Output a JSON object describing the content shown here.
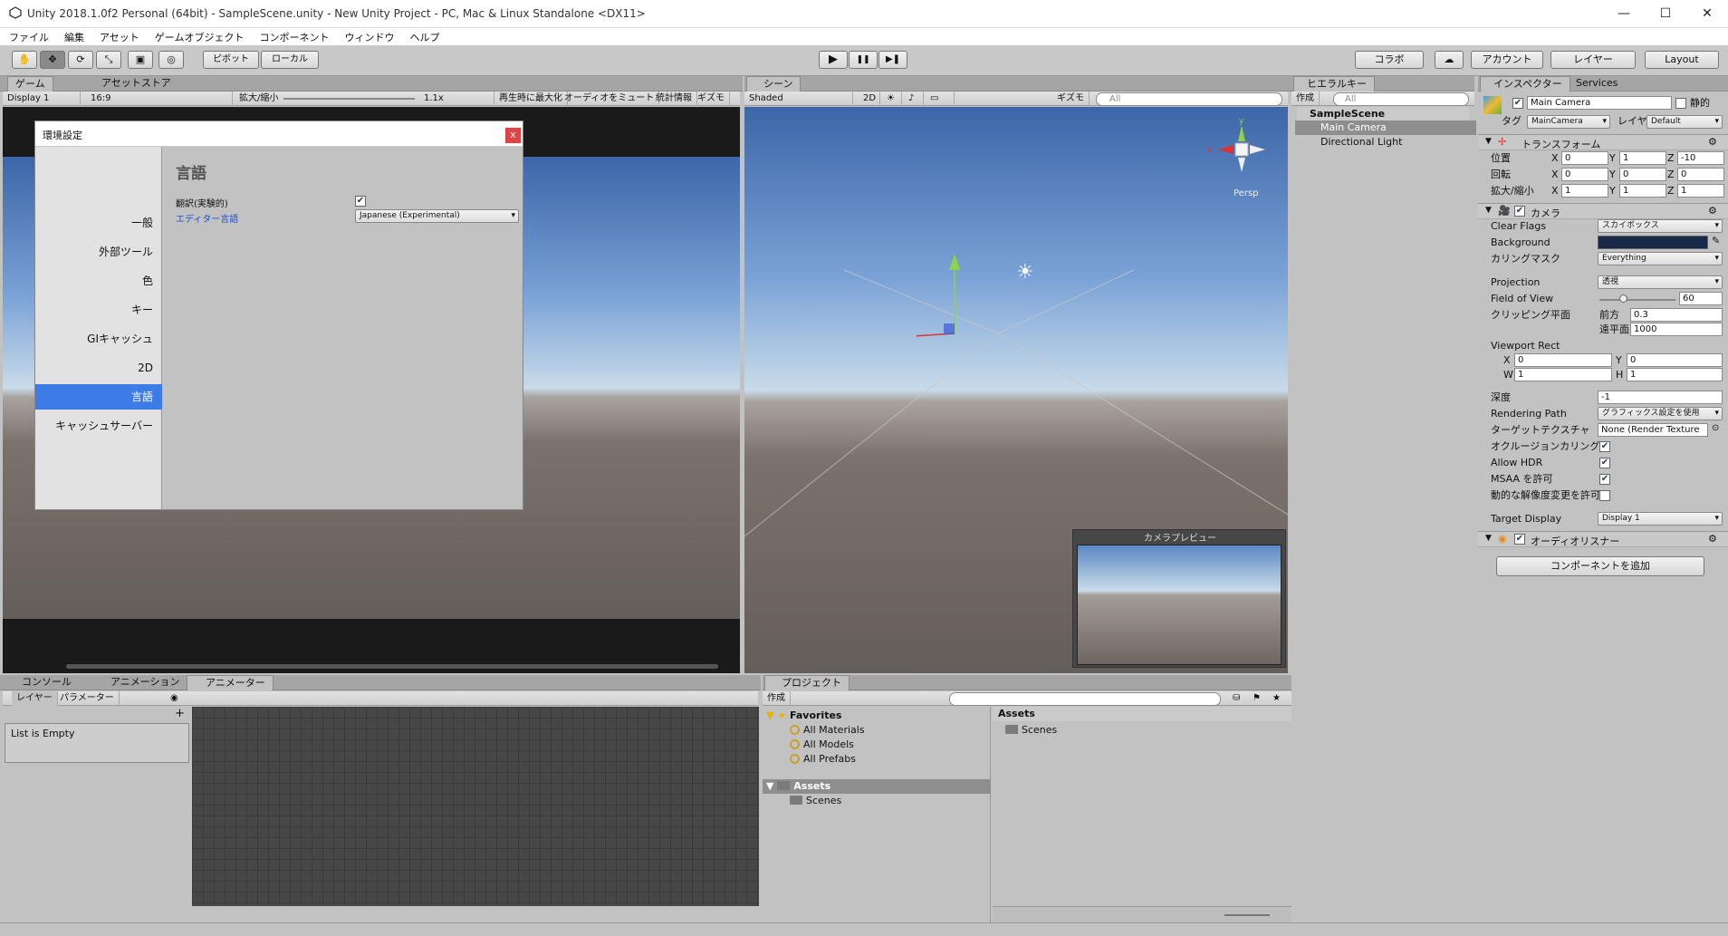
{
  "window": {
    "title": "Unity 2018.1.0f2 Personal (64bit) - SampleScene.unity - New Unity Project - PC, Mac & Linux Standalone <DX11>",
    "min": "—",
    "max": "☐",
    "close": "✕"
  },
  "menu": [
    "ファイル",
    "編集",
    "アセット",
    "ゲームオブジェクト",
    "コンポーネント",
    "ウィンドウ",
    "ヘルプ"
  ],
  "toolbar": {
    "pivot": "ピボット",
    "local": "ローカル",
    "collab": "コラボ",
    "account": "アカウント",
    "layers": "レイヤー",
    "layout": "Layout",
    "play": "▶",
    "pause": "❚❚",
    "step": "▶❚",
    "hand": "✋",
    "move": "✥",
    "rotate": "⟳",
    "scale": "⤡",
    "rect": "▣",
    "transform": "◎",
    "cloud": "☁"
  },
  "game": {
    "tab": "ゲーム",
    "tab2": "アセットストア",
    "display": "Display 1",
    "aspect": "16:9",
    "scale_label": "拡大/縮小",
    "scale_value": "1.1x",
    "maximize": "再生時に最大化",
    "mute": "オーディオをミュート",
    "stats": "統計情報",
    "gizmos": "ギズモ"
  },
  "prefs": {
    "title": "環境設定",
    "close": "x",
    "heading": "言語",
    "side": [
      "一般",
      "外部ツール",
      "色",
      "キー",
      "GIキャッシュ",
      "2D",
      "言語",
      "キャッシュサーバー"
    ],
    "selected_index": 6,
    "translate_label": "翻訳(実験的)",
    "translate_checked": "✔",
    "editor_lang_label": "エディター言語",
    "editor_lang_value": "Japanese (Experimental)"
  },
  "scene": {
    "tab": "シーン",
    "shading": "Shaded",
    "mode2d": "2D",
    "gizmos": "ギズモ",
    "search": "All",
    "persp": "Persp",
    "axis_y": "y",
    "axis_x": "x",
    "camera_preview": "カメラプレビュー"
  },
  "hierarchy": {
    "tab": "ヒエラルキー",
    "create": "作成",
    "search": "All",
    "scene": "SampleScene",
    "items": [
      "Main Camera",
      "Directional Light"
    ]
  },
  "inspector": {
    "tab": "インスペクター",
    "tab2": "Services",
    "name": "Main Camera",
    "static": "静的",
    "tag_label": "タグ",
    "tag": "MainCamera",
    "layer_label": "レイヤ",
    "layer": "Default",
    "transform": {
      "title": "トランスフォーム",
      "pos_label": "位置",
      "rot_label": "回転",
      "scale_label": "拡大/縮小",
      "pos": [
        "0",
        "1",
        "-10"
      ],
      "rot": [
        "0",
        "0",
        "0"
      ],
      "scale": [
        "1",
        "1",
        "1"
      ]
    },
    "camera": {
      "title": "カメラ",
      "clear_flags_label": "Clear Flags",
      "clear_flags": "スカイボックス",
      "background_label": "Background",
      "culling_label": "カリングマスク",
      "culling": "Everything",
      "projection_label": "Projection",
      "projection": "透視",
      "fov_label": "Field of View",
      "fov": "60",
      "clip_label": "クリッピング平面",
      "near_label": "前方",
      "near": "0.3",
      "far_label": "遠平面",
      "far": "1000",
      "viewport_label": "Viewport Rect",
      "vx": "0",
      "vy": "0",
      "vw": "1",
      "vh": "1",
      "depth_label": "深度",
      "depth": "-1",
      "render_path_label": "Rendering Path",
      "render_path": "グラフィックス設定を使用",
      "target_tex_label": "ターゲットテクスチャ",
      "target_tex": "None (Render Texture",
      "occlusion_label": "オクルージョンカリング",
      "hdr_label": "Allow HDR",
      "msaa_label": "MSAA を許可",
      "dyn_res_label": "動的な解像度変更を許可",
      "target_display_label": "Target Display",
      "target_display": "Display 1",
      "check": "✔"
    },
    "audio_listener": "オーディオリスナー",
    "add_component": "コンポーネントを追加"
  },
  "bottom": {
    "tabs": [
      "コンソール",
      "アニメーション",
      "アニメーター"
    ],
    "layer": "レイヤー",
    "params": "パラメーター",
    "empty": "List is Empty",
    "plus": "+"
  },
  "project": {
    "tab": "プロジェクト",
    "create": "作成",
    "favorites": "Favorites",
    "fav_items": [
      "All Materials",
      "All Models",
      "All Prefabs"
    ],
    "assets": "Assets",
    "assets_children": [
      "Scenes"
    ],
    "crumb": "Assets",
    "grid_items": [
      "Scenes"
    ]
  },
  "colors": {
    "selection": "#3d7be6",
    "panel": "#c2c2c2",
    "hier_sel": "#8e8e8e"
  }
}
